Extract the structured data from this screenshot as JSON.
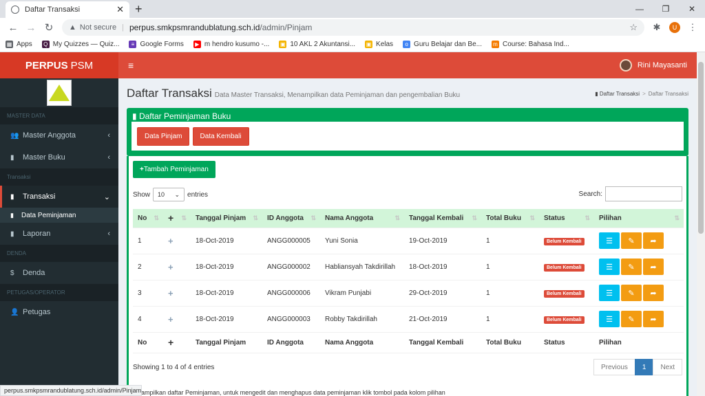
{
  "browser": {
    "tab_title": "Daftar Transaksi",
    "not_secure": "Not secure",
    "url_host": "perpus.smkpsmrandublatung.sch.id",
    "url_path": "/admin/Pinjam",
    "profile_initial": "U",
    "bookmarks": [
      {
        "label": "Apps",
        "color": "#5f6368"
      },
      {
        "label": "My Quizzes — Quiz...",
        "color": "#461a42"
      },
      {
        "label": "Google Forms",
        "color": "#673ab7"
      },
      {
        "label": "m hendro kusumo -...",
        "color": "#ff0000"
      },
      {
        "label": "10 AKL 2 Akuntansi...",
        "color": "#f4b400"
      },
      {
        "label": "Kelas",
        "color": "#f4b400"
      },
      {
        "label": "Guru Belajar dan Be...",
        "color": "#4285f4"
      },
      {
        "label": "Course: Bahasa Ind...",
        "color": "#f57c00"
      }
    ],
    "status_url": "perpus.smkpsmrandublatung.sch.id/admin/Pinjam"
  },
  "app": {
    "logo_bold": "PERPUS",
    "logo_rest": "PSM",
    "user_name": "Rini Mayasanti"
  },
  "sidebar": {
    "sections": {
      "master": "MASTER DATA",
      "transaksi": "Transaksi",
      "denda": "DENDA",
      "petugas": "PETUGAS/OPERATOR"
    },
    "items": {
      "master_anggota": "Master Anggota",
      "master_buku": "Master Buku",
      "transaksi": "Transaksi",
      "data_peminjaman": "Data Peminjaman",
      "laporan": "Laporan",
      "denda": "Denda",
      "petugas": "Petugas"
    }
  },
  "page": {
    "title": "Daftar Transaksi",
    "subtitle": "Data Master Transaksi, Menampilkan data Peminjaman dan pengembalian Buku",
    "breadcrumb_1": "Daftar Transaksi",
    "breadcrumb_2": "Daftar Transaksi",
    "box_title": "Daftar Peminjaman Buku",
    "btn_pinjam": "Data Pinjam",
    "btn_kembali": "Data Kembali",
    "btn_tambah": "Tambah Peminjaman",
    "show_label": "Show",
    "show_value": "10",
    "entries_label": "entries",
    "search_label": "Search:",
    "info": "Showing 1 to 4 of 4 entries",
    "prev": "Previous",
    "page_num": "1",
    "next": "Next",
    "footnote": "ampilkan daftar Peminjaman, untuk mengedit dan menghapus data peminjaman klik tombol pada kolom pilihan"
  },
  "table": {
    "headers": [
      "No",
      "+",
      "Tanggal Pinjam",
      "ID Anggota",
      "Nama Anggota",
      "Tanggal Kembali",
      "Total Buku",
      "Status",
      "Pilihan"
    ],
    "rows": [
      {
        "no": "1",
        "tgl_pinjam": "18-Oct-2019",
        "id": "ANGG000005",
        "nama": "Yuni Sonia",
        "tgl_kembali": "19-Oct-2019",
        "total": "1",
        "status": "Belum Kembali"
      },
      {
        "no": "2",
        "tgl_pinjam": "18-Oct-2019",
        "id": "ANGG000002",
        "nama": "Habliansyah Takdirillah",
        "tgl_kembali": "18-Oct-2019",
        "total": "1",
        "status": "Belum Kembali"
      },
      {
        "no": "3",
        "tgl_pinjam": "18-Oct-2019",
        "id": "ANGG000006",
        "nama": "Vikram Punjabi",
        "tgl_kembali": "29-Oct-2019",
        "total": "1",
        "status": "Belum Kembali"
      },
      {
        "no": "4",
        "tgl_pinjam": "18-Oct-2019",
        "id": "ANGG000003",
        "nama": "Robby Takdirillah",
        "tgl_kembali": "21-Oct-2019",
        "total": "1",
        "status": "Belum Kembali"
      }
    ]
  },
  "colors": {
    "brand_red": "#dd4b39",
    "box_green": "#00a65a",
    "info_blue": "#00c0ef",
    "warn_orange": "#f39c12"
  }
}
